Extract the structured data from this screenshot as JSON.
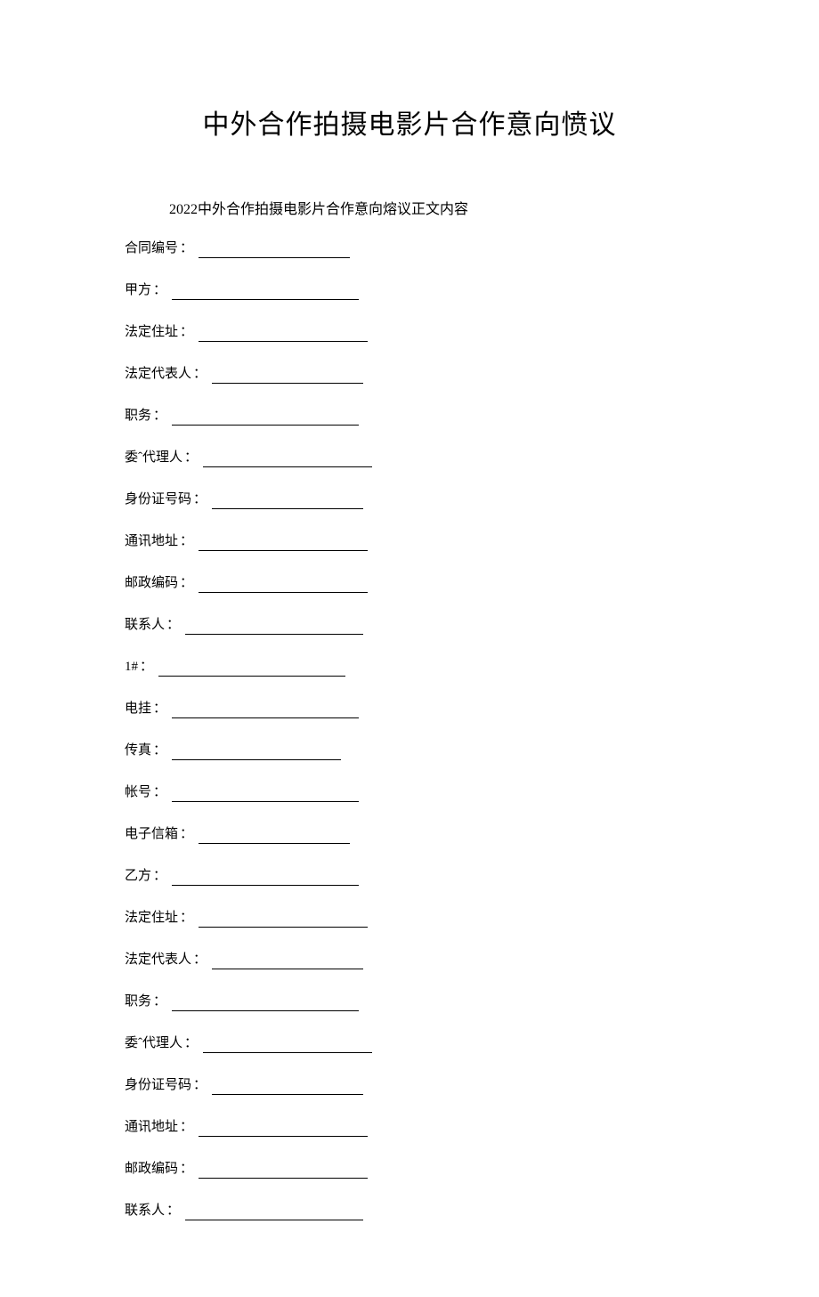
{
  "title": "中外合作拍摄电影片合作意向愤议",
  "subtitle": "2022中外合作拍摄电影片合作意向熔议正文内容",
  "fields": [
    {
      "label": "合同编号",
      "colon": "：",
      "lineClass": "w-short"
    },
    {
      "label": "甲方",
      "colon": "：",
      "lineClass": "w-long"
    },
    {
      "label": "法定住址",
      "colon": "：",
      "lineClass": "w-med"
    },
    {
      "label": "法定代表人",
      "colon": "：",
      "lineClass": "w-short"
    },
    {
      "label": "职务",
      "colon": "：",
      "lineClass": "w-long"
    },
    {
      "label": "委ˆ代理人",
      "colon": "：",
      "lineClass": "w-med"
    },
    {
      "label": "身份证号码",
      "colon": "：",
      "lineClass": "w-short"
    },
    {
      "label": "通讯地址",
      "colon": "：",
      "lineClass": "w-med"
    },
    {
      "label": "邮政编码",
      "colon": "：",
      "lineClass": "w-med"
    },
    {
      "label": "联系人",
      "colon": "：",
      "lineClass": "w-xlong"
    },
    {
      "label": "1#",
      "colon": "：",
      "lineClass": "w-long"
    },
    {
      "label": "电挂",
      "colon": "：",
      "lineClass": "w-long"
    },
    {
      "label": "传真",
      "colon": "：",
      "lineClass": "w-med"
    },
    {
      "label": "帐号",
      "colon": "：",
      "lineClass": "w-long"
    },
    {
      "label": "电子信箱",
      "colon": "：",
      "lineClass": "w-short"
    },
    {
      "label": "乙方",
      "colon": "：",
      "lineClass": "w-long"
    },
    {
      "label": "法定住址",
      "colon": "：",
      "lineClass": "w-med"
    },
    {
      "label": "法定代表人",
      "colon": "：",
      "lineClass": "w-short"
    },
    {
      "label": "职务",
      "colon": "：",
      "lineClass": "w-long"
    },
    {
      "label": "委ˆ代理人",
      "colon": "：",
      "lineClass": "w-med"
    },
    {
      "label": "身份证号码",
      "colon": "：",
      "lineClass": "w-short"
    },
    {
      "label": "通讯地址",
      "colon": "：",
      "lineClass": "w-med"
    },
    {
      "label": "邮政编码",
      "colon": "：",
      "lineClass": "w-med"
    },
    {
      "label": "联系人",
      "colon": "：",
      "lineClass": "w-xlong"
    }
  ]
}
